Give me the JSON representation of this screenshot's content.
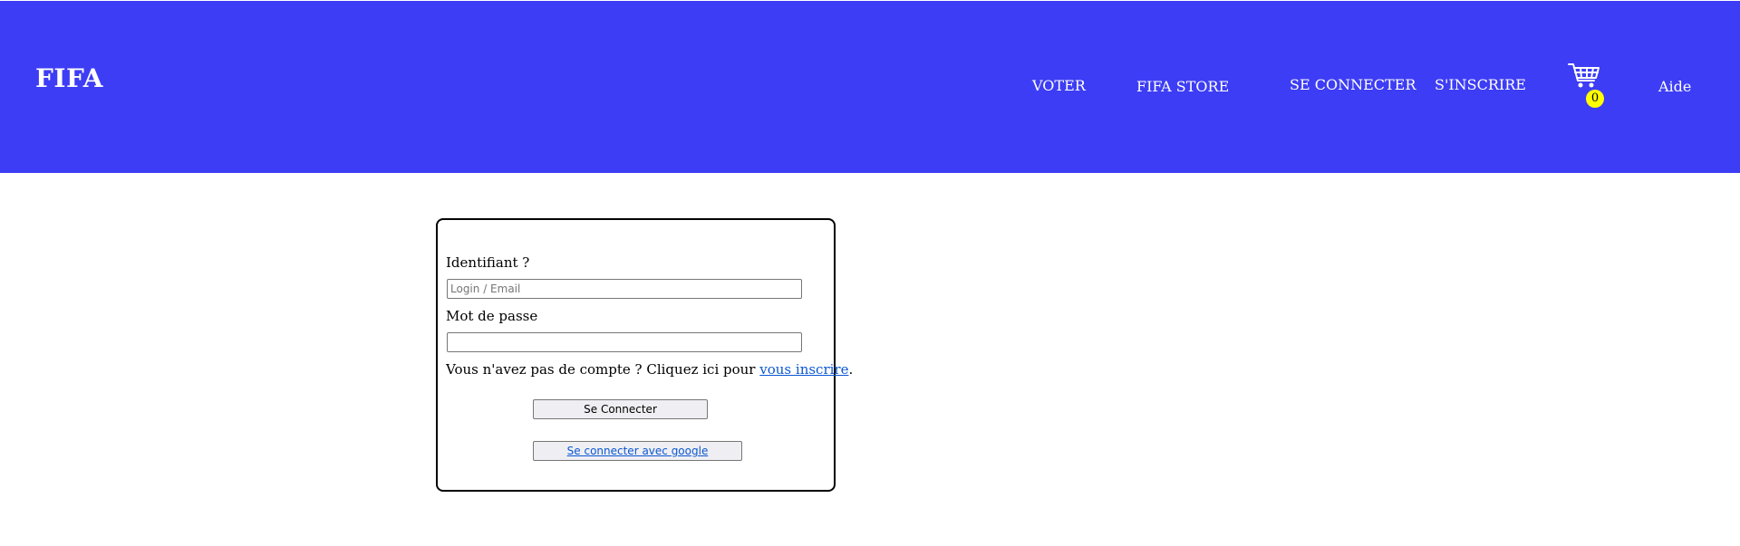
{
  "header": {
    "logo": "FIFA",
    "nav": {
      "voter": "VOTER",
      "store": "FIFA STORE",
      "login": "SE CONNECTER",
      "signup": "S'INSCRIRE",
      "help": "Aide"
    },
    "cart": {
      "icon": "shopping-cart-icon",
      "count": "0"
    }
  },
  "login_form": {
    "identifier_label": "Identifiant ?",
    "identifier_placeholder": "Login / Email",
    "identifier_value": "",
    "password_label": "Mot de passe",
    "password_value": "",
    "signup_prompt": "Vous n'avez pas de compte ? Cliquez ici pour",
    "signup_link": "vous inscrire",
    "signup_suffix": ".",
    "submit_label": "Se Connecter",
    "google_label": "Se connecter avec google"
  },
  "colors": {
    "header_bg": "#3d3df5",
    "badge_bg": "#ffff00",
    "link": "#0b57d0"
  }
}
